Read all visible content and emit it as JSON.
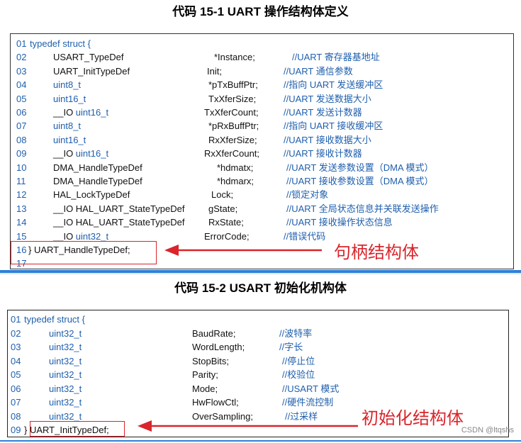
{
  "title1": "代码 15-1 UART 操作结构体定义",
  "title2": "代码 15-2 USART 初始化机构体",
  "block1": {
    "header_num": "01",
    "header_text": "typedef struct {",
    "rows": [
      {
        "num": "02",
        "type": "USART_TypeDef",
        "type_color": "black",
        "field": "*Instance;",
        "comment": "//UART 寄存器基地址"
      },
      {
        "num": "03",
        "type": "UART_InitTypeDef",
        "type_color": "black",
        "field": "Init;",
        "comment": "//UART 通信参数"
      },
      {
        "num": "04",
        "type": "uint8_t",
        "type_color": "blue",
        "field": "*pTxBuffPtr;",
        "comment": "//指向 UART 发送缓冲区"
      },
      {
        "num": "05",
        "type": "uint16_t",
        "type_color": "blue",
        "field": "TxXferSize;",
        "comment": "//UART 发送数据大小"
      },
      {
        "num": "06",
        "type_prefix": "__IO ",
        "type": "uint16_t",
        "type_color": "blue",
        "field": "TxXferCount;",
        "comment": "//UART 发送计数器"
      },
      {
        "num": "07",
        "type": "uint8_t",
        "type_color": "blue",
        "field": "*pRxBuffPtr;",
        "comment": "//指向 UART 接收缓冲区"
      },
      {
        "num": "08",
        "type": "uint16_t",
        "type_color": "blue",
        "field": "RxXferSize;",
        "comment": "//UART 接收数据大小"
      },
      {
        "num": "09",
        "type_prefix": "__IO ",
        "type": "uint16_t",
        "type_color": "blue",
        "field": "RxXferCount;",
        "comment": "//UART 接收计数器"
      },
      {
        "num": "10",
        "type": "DMA_HandleTypeDef",
        "type_color": "black",
        "field": "*hdmatx;",
        "comment": "//UART 发送参数设置（DMA 模式）"
      },
      {
        "num": "11",
        "type": "DMA_HandleTypeDef",
        "type_color": "black",
        "field": "*hdmarx;",
        "comment": "//UART 接收参数设置（DMA 模式）"
      },
      {
        "num": "12",
        "type": "HAL_LockTypeDef",
        "type_color": "black",
        "field": "Lock;",
        "comment": "//锁定对象"
      },
      {
        "num": "13",
        "type_prefix": "__IO ",
        "type": "HAL_UART_StateTypeDef",
        "type_color": "black",
        "field": "gState;",
        "comment": "//UART 全局状态信息并关联发送操作"
      },
      {
        "num": "14",
        "type_prefix": "__IO ",
        "type": "HAL_UART_StateTypeDef",
        "type_color": "black",
        "field": "RxState;",
        "comment": "//UART 接收操作状态信息"
      },
      {
        "num": "15",
        "type_prefix": "__IO ",
        "type": "uint32_t",
        "type_color": "blue",
        "field": "ErrorCode;",
        "comment": "//错误代码"
      }
    ],
    "closing_num": "16",
    "closing_text": "} UART_HandleTypeDef;",
    "last_num": "17",
    "annotation": "句柄结构体"
  },
  "block2": {
    "header_num": "01",
    "header_text": "typedef struct {",
    "rows": [
      {
        "num": "02",
        "type": "uint32_t",
        "field": "BaudRate;",
        "comment": "//波特率"
      },
      {
        "num": "03",
        "type": "uint32_t",
        "field": "WordLength;",
        "comment": "//字长"
      },
      {
        "num": "04",
        "type": "uint32_t",
        "field": "StopBits;",
        "comment": "//停止位"
      },
      {
        "num": "05",
        "type": "uint32_t",
        "field": "Parity;",
        "comment": "//校验位"
      },
      {
        "num": "06",
        "type": "uint32_t",
        "field": "Mode;",
        "comment": "//USART 模式"
      },
      {
        "num": "07",
        "type": "uint32_t",
        "field": "HwFlowCtl;",
        "comment": "//硬件流控制"
      },
      {
        "num": "08",
        "type": "uint32_t",
        "field": "OverSampling;",
        "comment": "//过采样"
      }
    ],
    "closing_num": "09",
    "closing_text": "} UART_InitTypeDef;",
    "annotation": "初始化结构体"
  },
  "watermark": "CSDN @ltqshs",
  "colors": {
    "code_blue": "#1f5fad",
    "annotation_red": "#d9252b",
    "separator_blue": "#2f7fd6"
  }
}
